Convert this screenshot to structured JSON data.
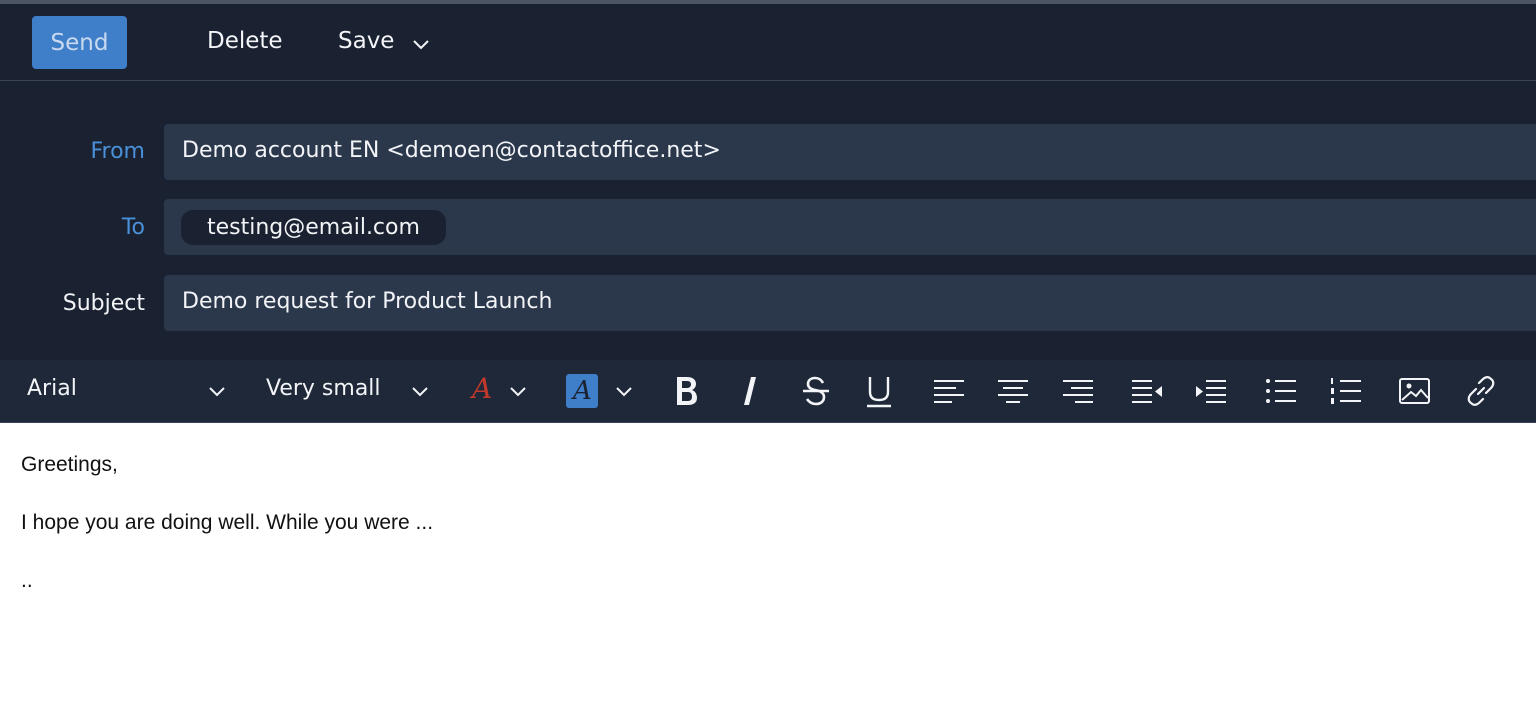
{
  "toolbar": {
    "send_label": "Send",
    "delete_label": "Delete",
    "save_label": "Save"
  },
  "compose": {
    "from": {
      "label": "From",
      "value": "Demo account EN <demoen@contactoffice.net>"
    },
    "to": {
      "label": "To",
      "recipients": [
        "testing@email.com"
      ]
    },
    "subject": {
      "label": "Subject",
      "value": "Demo request for Product Launch"
    }
  },
  "format_bar": {
    "font": "Arial",
    "size": "Very small",
    "text_color_glyph": "A",
    "highlight_glyph": "A",
    "icons": [
      "bold-icon",
      "italic-icon",
      "strikethrough-icon",
      "underline-icon",
      "align-left-icon",
      "align-center-icon",
      "align-right-icon",
      "outdent-icon",
      "indent-icon",
      "bullet-list-icon",
      "numbered-list-icon",
      "image-icon",
      "link-icon"
    ]
  },
  "body": {
    "lines": [
      "Greetings,",
      "I hope you are doing well. While you were ...",
      ".."
    ]
  },
  "colors": {
    "background_dark": "#1a2130",
    "field_bg": "#2b374b",
    "accent_blue": "#3f7fc9",
    "label_blue": "#4a90d9",
    "text_color_red": "#c0392b"
  }
}
